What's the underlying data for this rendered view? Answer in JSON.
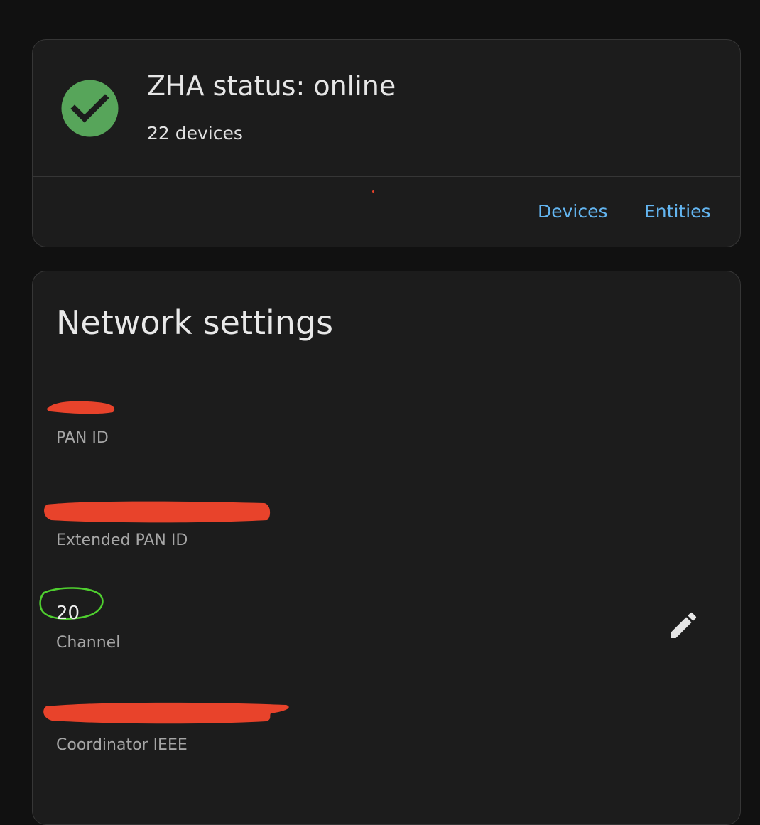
{
  "status": {
    "title": "ZHA status: online",
    "device_count": "22 devices",
    "icon": "check-circle-icon",
    "icon_color": "#57a55a",
    "actions": {
      "devices": "Devices",
      "entities": "Entities"
    },
    "link_color": "#63b5f0"
  },
  "network": {
    "title": "Network settings",
    "settings": [
      {
        "label": "PAN ID",
        "value": "",
        "redacted": true
      },
      {
        "label": "Extended PAN ID",
        "value": "",
        "redacted": true
      },
      {
        "label": "Channel",
        "value": "20",
        "redacted": false,
        "highlighted": true
      },
      {
        "label": "Coordinator IEEE",
        "value": "",
        "redacted": true
      }
    ],
    "edit_icon": "pencil-icon",
    "redaction_color": "#e8432b",
    "highlight_color": "#4fcf2f"
  }
}
